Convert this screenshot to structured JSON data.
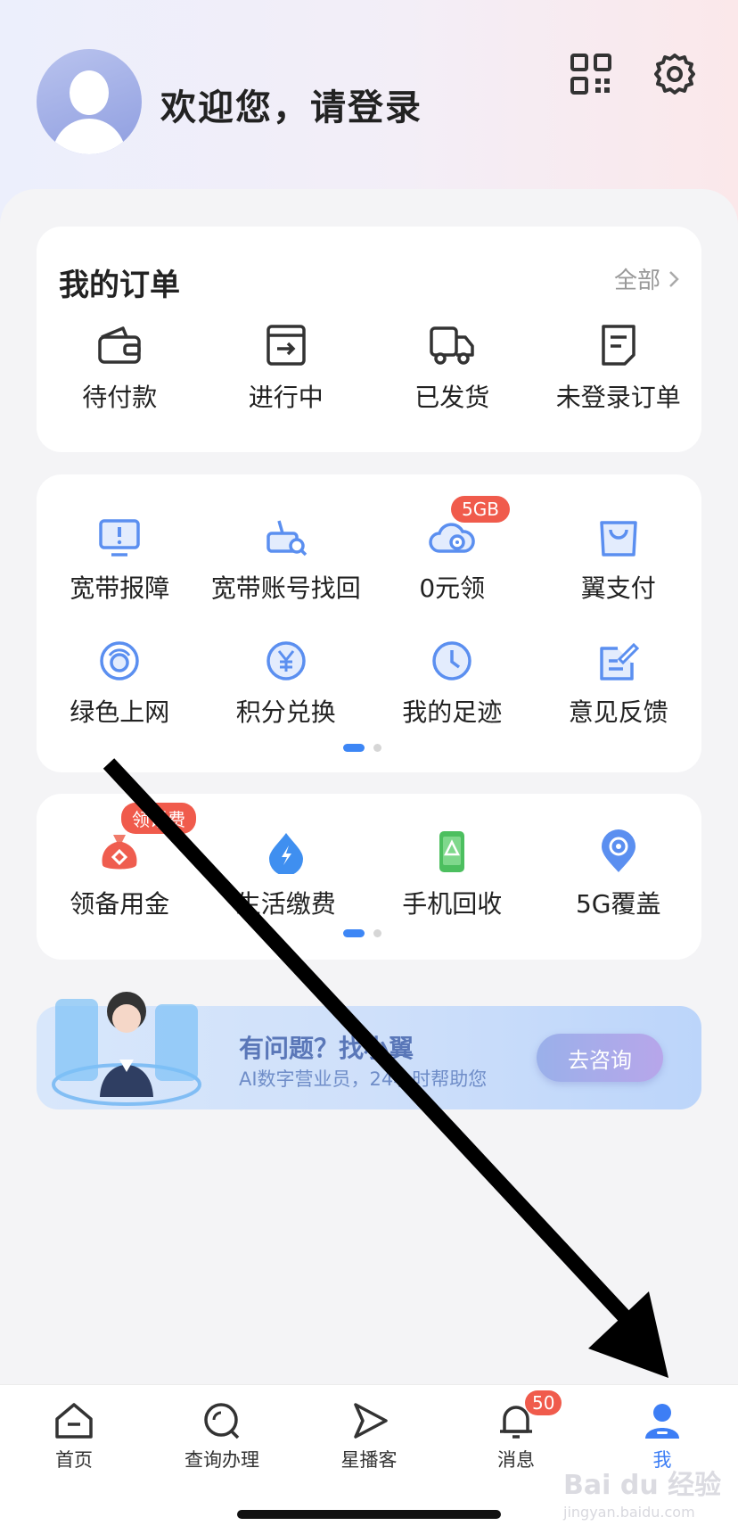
{
  "header": {
    "welcome": "欢迎您，请登录"
  },
  "orders": {
    "title": "我的订单",
    "all_label": "全部",
    "items": [
      {
        "label": "待付款",
        "icon": "wallet-icon"
      },
      {
        "label": "进行中",
        "icon": "box-arrow-icon"
      },
      {
        "label": "已发货",
        "icon": "truck-icon"
      },
      {
        "label": "未登录订单",
        "icon": "document-icon"
      }
    ]
  },
  "services": {
    "items": [
      {
        "label": "宽带报障",
        "icon": "monitor-alert-icon"
      },
      {
        "label": "宽带账号找回",
        "icon": "router-search-icon"
      },
      {
        "label": "0元领",
        "icon": "cloud-icon",
        "badge": "5GB"
      },
      {
        "label": "翼支付",
        "icon": "shopping-bag-icon"
      },
      {
        "label": "绿色上网",
        "icon": "shield-circle-icon"
      },
      {
        "label": "积分兑换",
        "icon": "yuan-coin-icon"
      },
      {
        "label": "我的足迹",
        "icon": "clock-icon"
      },
      {
        "label": "意见反馈",
        "icon": "edit-note-icon"
      }
    ]
  },
  "life": {
    "items": [
      {
        "label": "领备用金",
        "icon": "money-bag-icon",
        "badge": "领话费"
      },
      {
        "label": "生活缴费",
        "icon": "bolt-drop-icon"
      },
      {
        "label": "手机回收",
        "icon": "phone-recycle-icon"
      },
      {
        "label": "5G覆盖",
        "icon": "location-pin-icon"
      }
    ]
  },
  "banner": {
    "title": "有问题？找小翼",
    "subtitle": "AI数字营业员，24小时帮助您",
    "button": "去咨询"
  },
  "tabbar": {
    "items": [
      {
        "label": "首页",
        "icon": "home-icon"
      },
      {
        "label": "查询办理",
        "icon": "search-icon"
      },
      {
        "label": "星播客",
        "icon": "play-icon"
      },
      {
        "label": "消息",
        "icon": "bell-icon",
        "badge": "50"
      },
      {
        "label": "我",
        "icon": "user-icon"
      }
    ]
  },
  "watermark": {
    "text": "Bai du 经验",
    "sub": "jingyan.baidu.com"
  },
  "colors": {
    "accent": "#3d7ef5",
    "badge": "#f05b4c"
  }
}
